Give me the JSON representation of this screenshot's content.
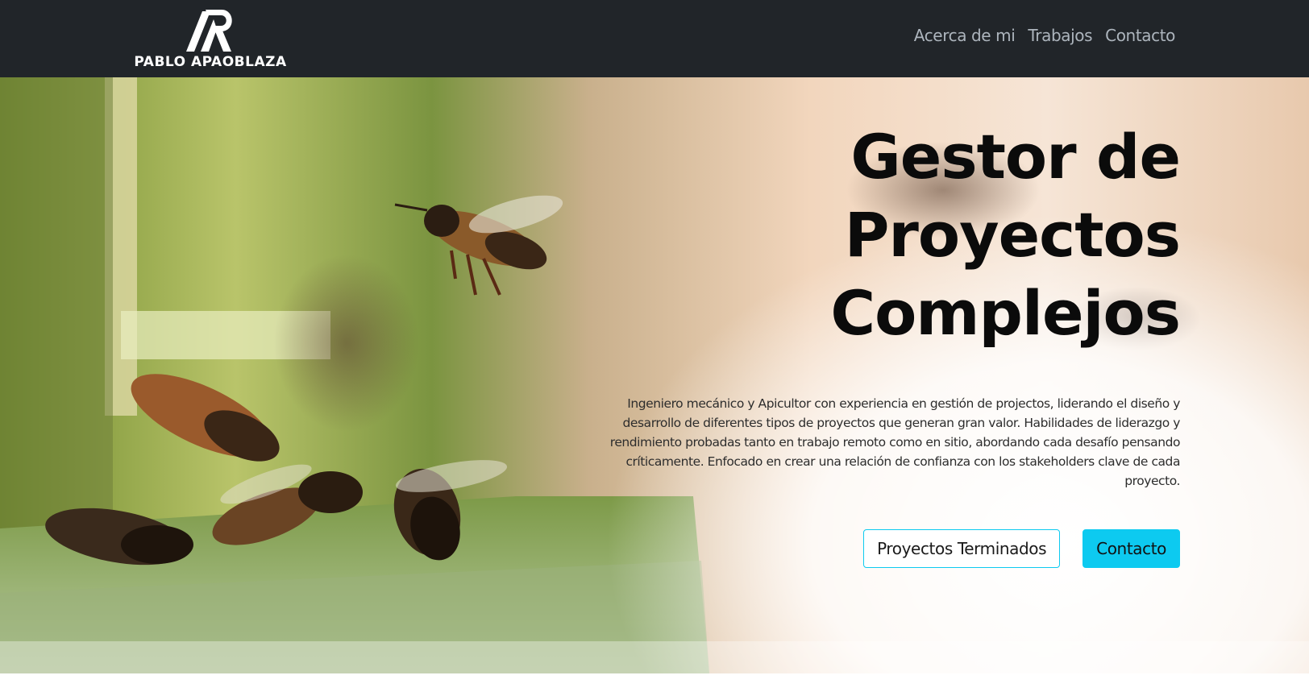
{
  "navbar": {
    "brand_name": "PABLO APAOBLAZA",
    "links": [
      "Acerca de mi",
      "Trabajos",
      "Contacto"
    ],
    "background": "#212529",
    "link_color": "#adb5bd"
  },
  "hero": {
    "title_lines": [
      "Gestor de",
      "Proyectos",
      "Complejos"
    ],
    "description": "Ingeniero mecánico y Apicultor con experiencia en gestión de projectos, liderando el diseño y desarrollo de diferentes tipos de proyectos que generan gran valor. Habilidades de liderazgo y rendimiento probadas tanto en trabajo remoto como en sitio, abordando cada desafío pensando críticamente. Enfocado en crear una relación de confianza con los stakeholders clave de cada proyecto.",
    "buttons": {
      "outline_label": "Proyectos Terminados",
      "primary_label": "Contacto"
    },
    "accent_color": "#0dcaf0",
    "background_image": "bees-flying-near-hive-photo"
  }
}
